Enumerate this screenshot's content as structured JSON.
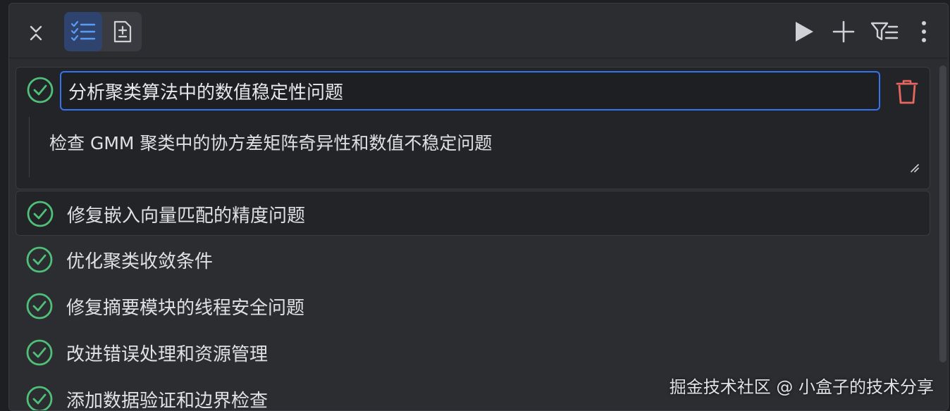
{
  "toolbar": {
    "collapse_icon": "collapse-expand-icon",
    "view_todo_icon": "checklist-icon",
    "view_add_icon": "add-document-icon",
    "run_icon": "play-icon",
    "add_icon": "plus-icon",
    "filter_icon": "filter-list-icon",
    "more_icon": "more-vertical-icon"
  },
  "tasks": {
    "editing": {
      "title": "分析聚类算法中的数值稳定性问题",
      "description": "检查 GMM 聚类中的协方差矩阵奇异性和数值不稳定问题"
    },
    "items": [
      {
        "label": "修复嵌入向量匹配的精度问题"
      },
      {
        "label": "优化聚类收敛条件"
      },
      {
        "label": "修复摘要模块的线程安全问题"
      },
      {
        "label": "改进错误处理和资源管理"
      },
      {
        "label": "添加数据验证和边界检查"
      }
    ]
  },
  "colors": {
    "accent": "#3574f0",
    "success": "#4fbf7a",
    "danger": "#e5675f",
    "background": "#2b2d30"
  },
  "watermark": "掘金技术社区 @ 小盒子的技术分享"
}
